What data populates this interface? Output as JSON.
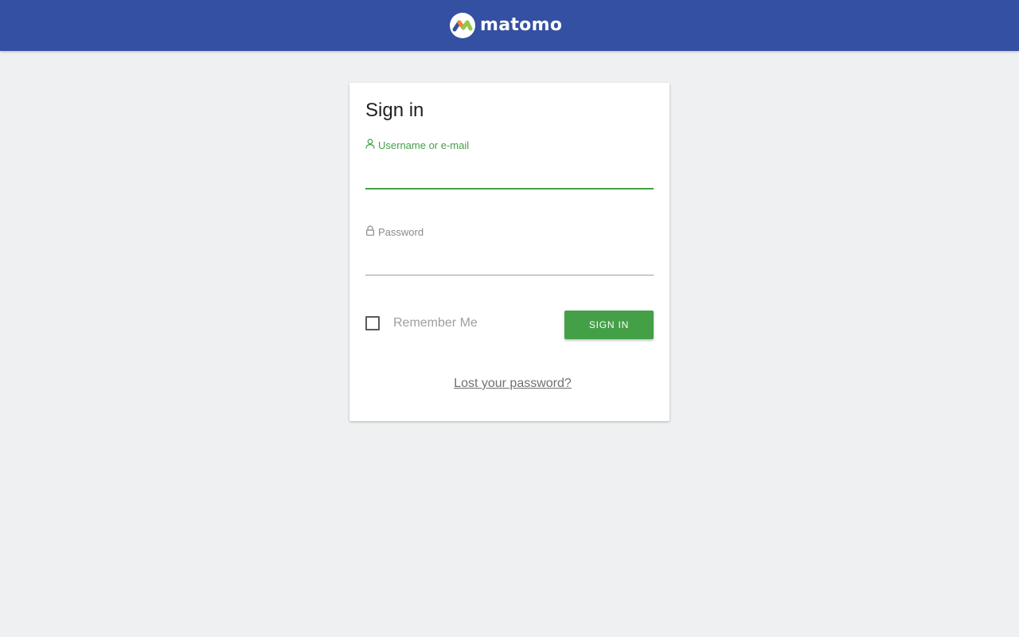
{
  "header": {
    "logo_text": "matomo",
    "bg_color": "#3450a3"
  },
  "login": {
    "title": "Sign in",
    "username_label": "Username or e-mail",
    "username_value": "",
    "password_label": "Password",
    "password_value": "",
    "remember_label": "Remember Me",
    "remember_checked": false,
    "signin_button": "SIGN IN",
    "lost_password_link": "Lost your password?",
    "accent_color": "#43a047"
  },
  "icons": {
    "username": "user-icon",
    "password": "lock-icon",
    "logo": "matomo-logo-icon"
  }
}
